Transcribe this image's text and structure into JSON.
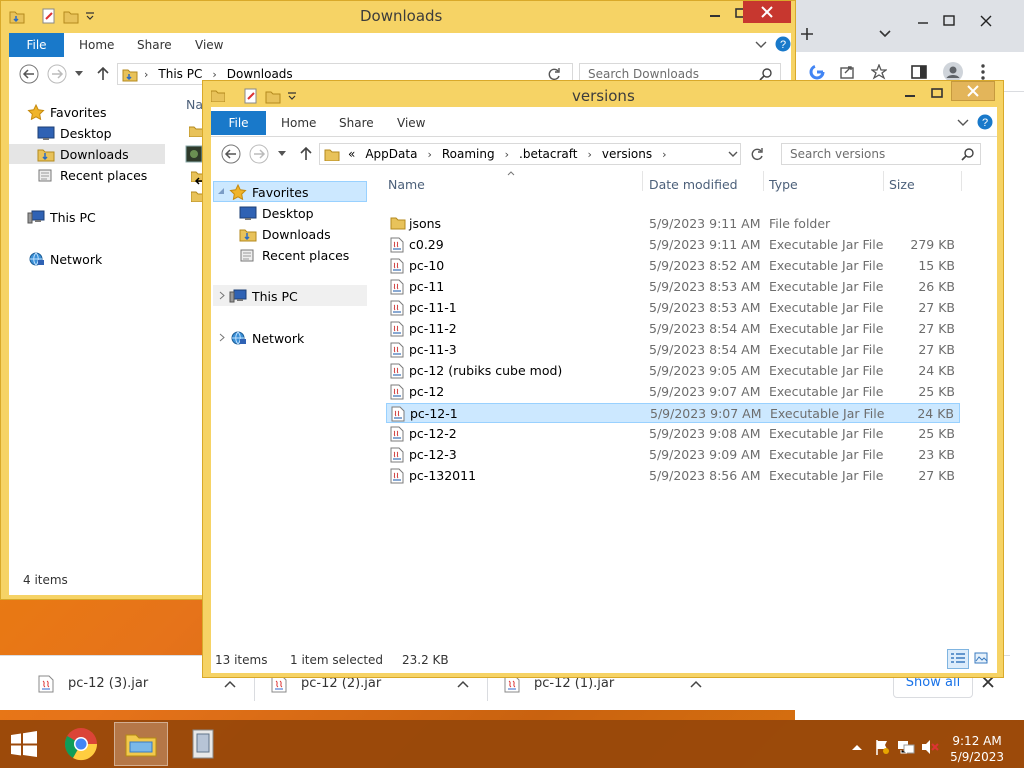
{
  "downloads_window": {
    "title": "Downloads",
    "ribbon_tabs": [
      "File",
      "Home",
      "Share",
      "View"
    ],
    "address": {
      "crumbs": [
        "This PC",
        "Downloads"
      ]
    },
    "search_placeholder": "Search Downloads",
    "nav": {
      "favorites": "Favorites",
      "desktop": "Desktop",
      "downloads": "Downloads",
      "recent": "Recent places",
      "this_pc": "This PC",
      "network": "Network"
    },
    "col_name_partial": "Nar",
    "status": "4 items"
  },
  "versions_window": {
    "title": "versions",
    "ribbon_tabs": [
      "File",
      "Home",
      "Share",
      "View"
    ],
    "address": {
      "overflow": "«",
      "crumbs": [
        "AppData",
        "Roaming",
        ".betacraft",
        "versions"
      ]
    },
    "search_placeholder": "Search versions",
    "nav": {
      "favorites": "Favorites",
      "desktop": "Desktop",
      "downloads": "Downloads",
      "recent": "Recent places",
      "this_pc": "This PC",
      "network": "Network"
    },
    "columns": {
      "name": "Name",
      "date": "Date modified",
      "type": "Type",
      "size": "Size"
    },
    "files": [
      {
        "name": "jsons",
        "date": "5/9/2023 9:11 AM",
        "type": "File folder",
        "size": "",
        "icon": "folder-icon"
      },
      {
        "name": "c0.29",
        "date": "5/9/2023 9:11 AM",
        "type": "Executable Jar File",
        "size": "279 KB",
        "icon": "jar-file-icon"
      },
      {
        "name": "pc-10",
        "date": "5/9/2023 8:52 AM",
        "type": "Executable Jar File",
        "size": "15 KB",
        "icon": "jar-file-icon"
      },
      {
        "name": "pc-11",
        "date": "5/9/2023 8:53 AM",
        "type": "Executable Jar File",
        "size": "26 KB",
        "icon": "jar-file-icon"
      },
      {
        "name": "pc-11-1",
        "date": "5/9/2023 8:53 AM",
        "type": "Executable Jar File",
        "size": "27 KB",
        "icon": "jar-file-icon"
      },
      {
        "name": "pc-11-2",
        "date": "5/9/2023 8:54 AM",
        "type": "Executable Jar File",
        "size": "27 KB",
        "icon": "jar-file-icon"
      },
      {
        "name": "pc-11-3",
        "date": "5/9/2023 8:54 AM",
        "type": "Executable Jar File",
        "size": "27 KB",
        "icon": "jar-file-icon"
      },
      {
        "name": "pc-12 (rubiks cube mod)",
        "date": "5/9/2023 9:05 AM",
        "type": "Executable Jar File",
        "size": "24 KB",
        "icon": "jar-file-icon"
      },
      {
        "name": "pc-12",
        "date": "5/9/2023 9:07 AM",
        "type": "Executable Jar File",
        "size": "25 KB",
        "icon": "jar-file-icon"
      },
      {
        "name": "pc-12-1",
        "date": "5/9/2023 9:07 AM",
        "type": "Executable Jar File",
        "size": "24 KB",
        "icon": "jar-file-icon",
        "selected": true
      },
      {
        "name": "pc-12-2",
        "date": "5/9/2023 9:08 AM",
        "type": "Executable Jar File",
        "size": "25 KB",
        "icon": "jar-file-icon"
      },
      {
        "name": "pc-12-3",
        "date": "5/9/2023 9:09 AM",
        "type": "Executable Jar File",
        "size": "23 KB",
        "icon": "jar-file-icon"
      },
      {
        "name": "pc-132011",
        "date": "5/9/2023 8:56 AM",
        "type": "Executable Jar File",
        "size": "27 KB",
        "icon": "jar-file-icon"
      }
    ],
    "status": {
      "items": "13 items",
      "selected": "1 item selected",
      "size": "23.2 KB"
    }
  },
  "download_bar": {
    "items": [
      "pc-12 (3).jar",
      "pc-12 (2).jar",
      "pc-12 (1).jar"
    ],
    "show_all": "Show all"
  },
  "clock": {
    "time": "9:12 AM",
    "date": "5/9/2023"
  },
  "colors": {
    "accent": "#1979ca",
    "selection": "#cce8ff",
    "window_frame": "#f6d365"
  }
}
